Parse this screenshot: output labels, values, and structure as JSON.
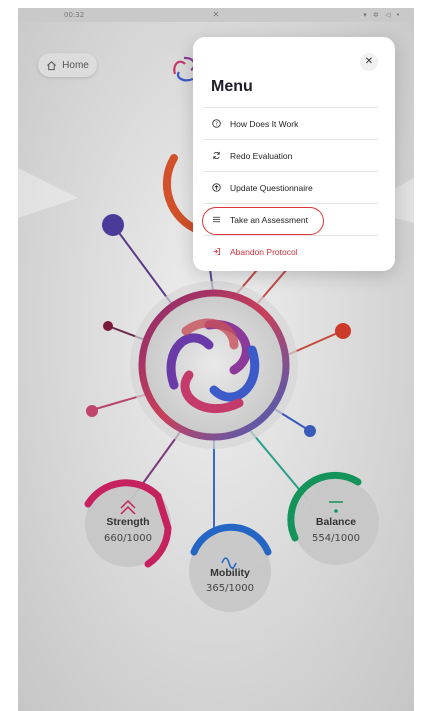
{
  "status_bar": {
    "time": "00:32",
    "center_icon": "logo-mark-icon",
    "right_icons": "▾ ✲ ◁ •"
  },
  "header": {
    "home_label": "Home",
    "home_icon": "home-icon",
    "logo_icon": "logo-icon"
  },
  "metrics": [
    {
      "name": "Strength",
      "value": "660/1000",
      "icon": "double-chevron-up-icon",
      "color": "#c6225f"
    },
    {
      "name": "Mobility",
      "value": "365/1000",
      "icon": "wave-icon",
      "color": "#2566c4"
    },
    {
      "name": "Balance",
      "value": "554/1000",
      "icon": "balance-icon",
      "color": "#14935a"
    }
  ],
  "menu": {
    "title": "Menu",
    "close_icon": "close-icon",
    "items": [
      {
        "label": "How Does It Work",
        "icon": "question-circle-icon"
      },
      {
        "label": "Redo Evaluation",
        "icon": "refresh-icon"
      },
      {
        "label": "Update Questionnaire",
        "icon": "upload-circle-icon"
      },
      {
        "label": "Take an Assessment",
        "icon": "list-icon"
      },
      {
        "label": "Abandon Protocol",
        "icon": "logout-icon"
      }
    ],
    "highlighted_item": "Take an Assessment"
  },
  "colors": {
    "danger": "#d1313b",
    "highlight_ring": "#e0343b"
  }
}
